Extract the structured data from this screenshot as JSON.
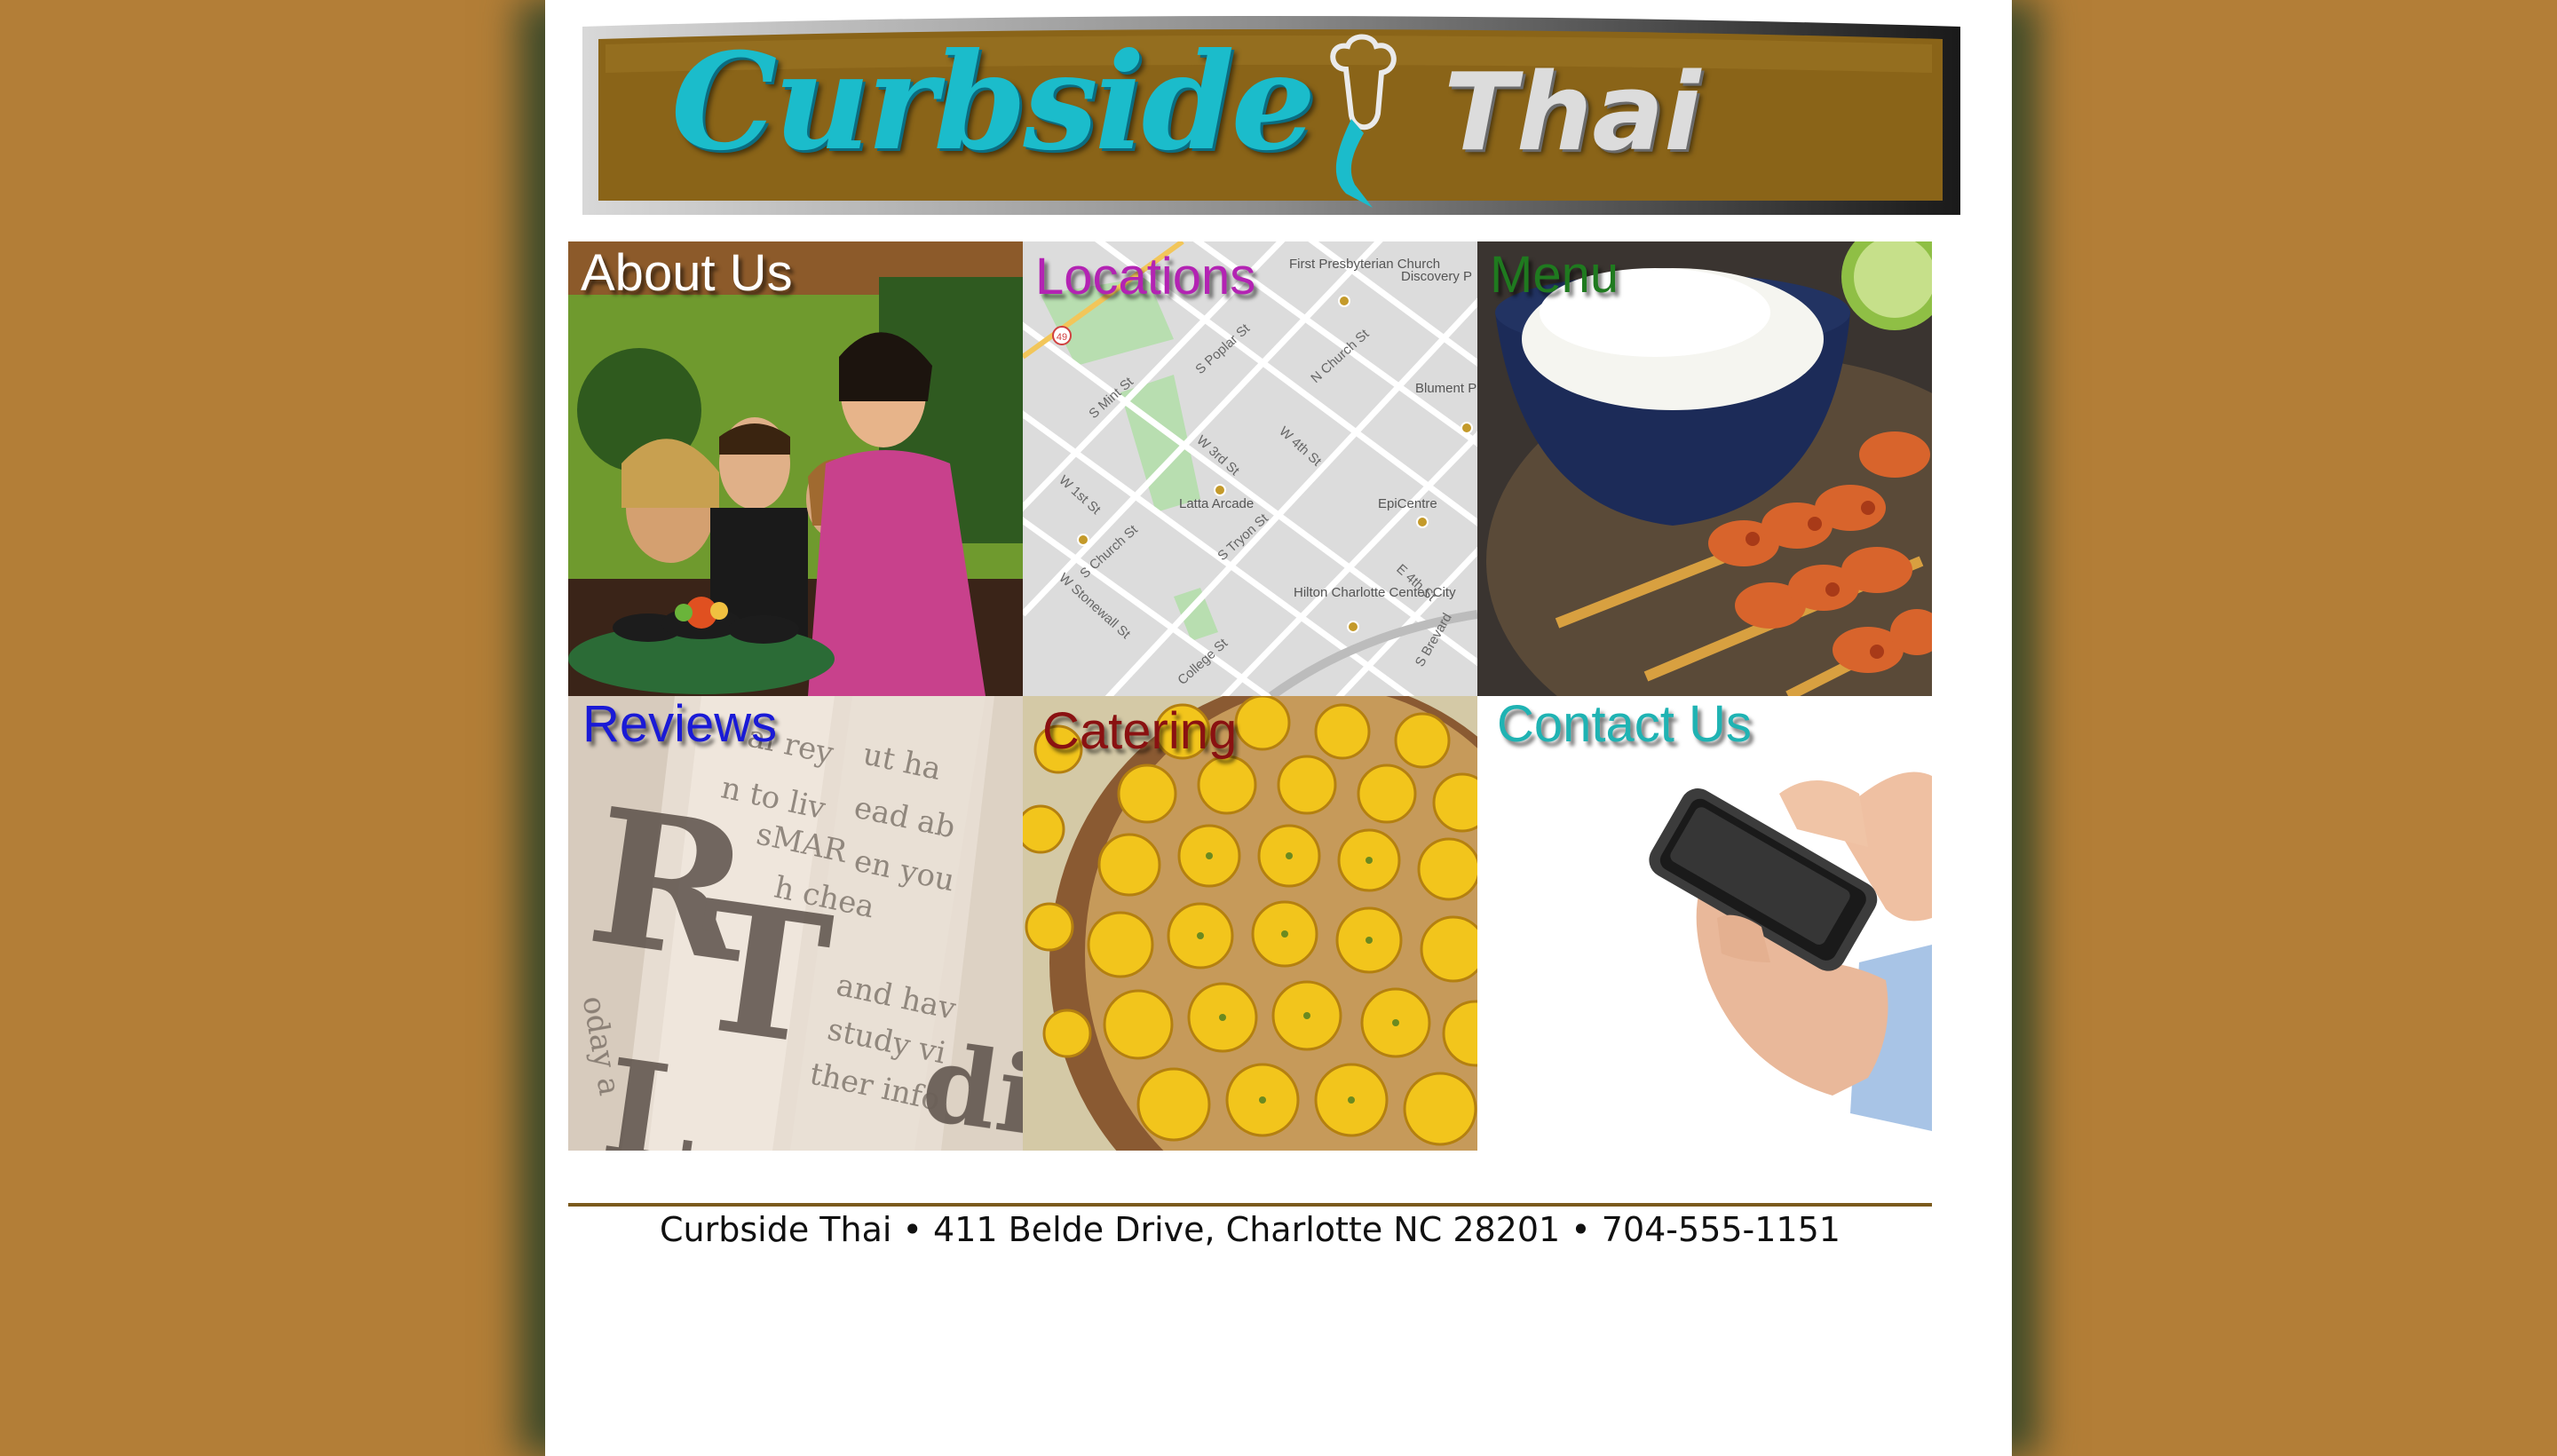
{
  "logo": {
    "word1": "Curbside",
    "word2": "Thai",
    "banner_color": "#8a6418",
    "word1_color": "#1bbccb",
    "word2_color": "#d9d9d9"
  },
  "tiles": [
    {
      "label": "About Us",
      "color": "#ffffff",
      "icon": "restaurant-photo"
    },
    {
      "label": "Locations",
      "color": "#b323b3",
      "icon": "street-map"
    },
    {
      "label": "Menu",
      "color": "#1f7a1f",
      "icon": "rice-and-shrimp-photo"
    },
    {
      "label": "Reviews",
      "color": "#1a1ad6",
      "icon": "newspaper-photo"
    },
    {
      "label": "Catering",
      "color": "#8a1111",
      "icon": "dessert-tray-photo"
    },
    {
      "label": "Contact Us",
      "color": "#1fb3b3",
      "icon": "smartphone-photo"
    }
  ],
  "map_labels": {
    "church": "First Presbyterian Church",
    "discovery": "Discovery P",
    "blument": "Blument Performin",
    "latta": "Latta Arcade",
    "epicentre": "EpiCentre",
    "hilton": "Hilton Charlotte Center City",
    "mint": "S Mint St",
    "poplar": "S Poplar St",
    "nchurch": "N Church St",
    "w3rd": "W 3rd St",
    "w4th": "W 4th St",
    "w1st": "W 1st St",
    "schurch": "S Church St",
    "tryon": "S Tryon St",
    "stonewall": "W Stonewall St",
    "college": "College St",
    "e4th": "E 4th St",
    "brevard": "S Brevard",
    "route": "49"
  },
  "footer": {
    "text": "Curbside Thai • 411 Belde Drive, Charlotte NC 28201 • 704-555-1151"
  }
}
